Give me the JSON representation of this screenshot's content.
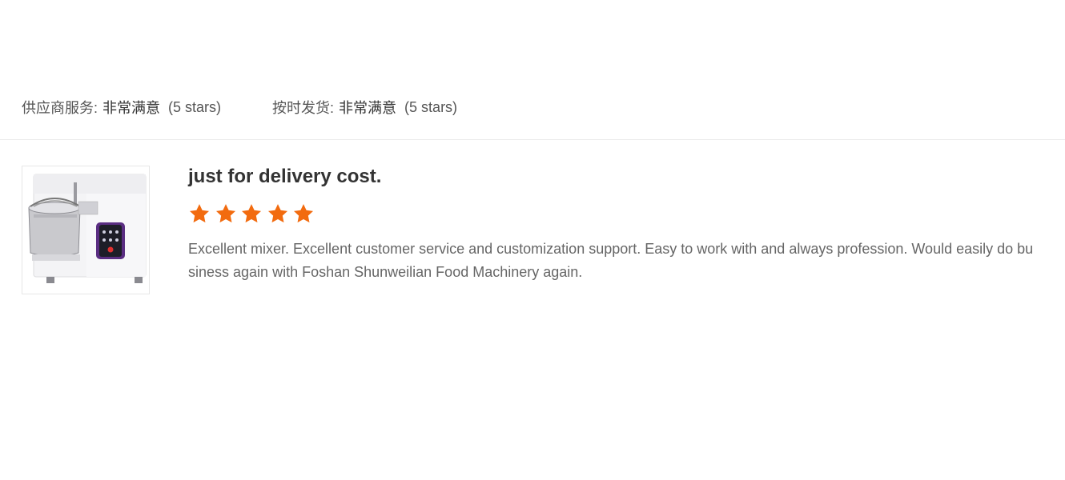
{
  "ratings": {
    "supplier_service": {
      "label": "供应商服务:",
      "value": "非常满意",
      "stars_text": "(5 stars)"
    },
    "on_time_delivery": {
      "label": "按时发货:",
      "value": "非常满意",
      "stars_text": "(5 stars)"
    }
  },
  "review": {
    "title": "just for delivery cost.",
    "rating": 5,
    "max_rating": 5,
    "star_color": "#f26b0f",
    "body": "Excellent mixer. Excellent customer service and customization support. Easy to work with and always profession. Would easily do business again with Foshan Shunweilian Food Machinery again.",
    "thumbnail": "spiral-dough-mixer"
  }
}
